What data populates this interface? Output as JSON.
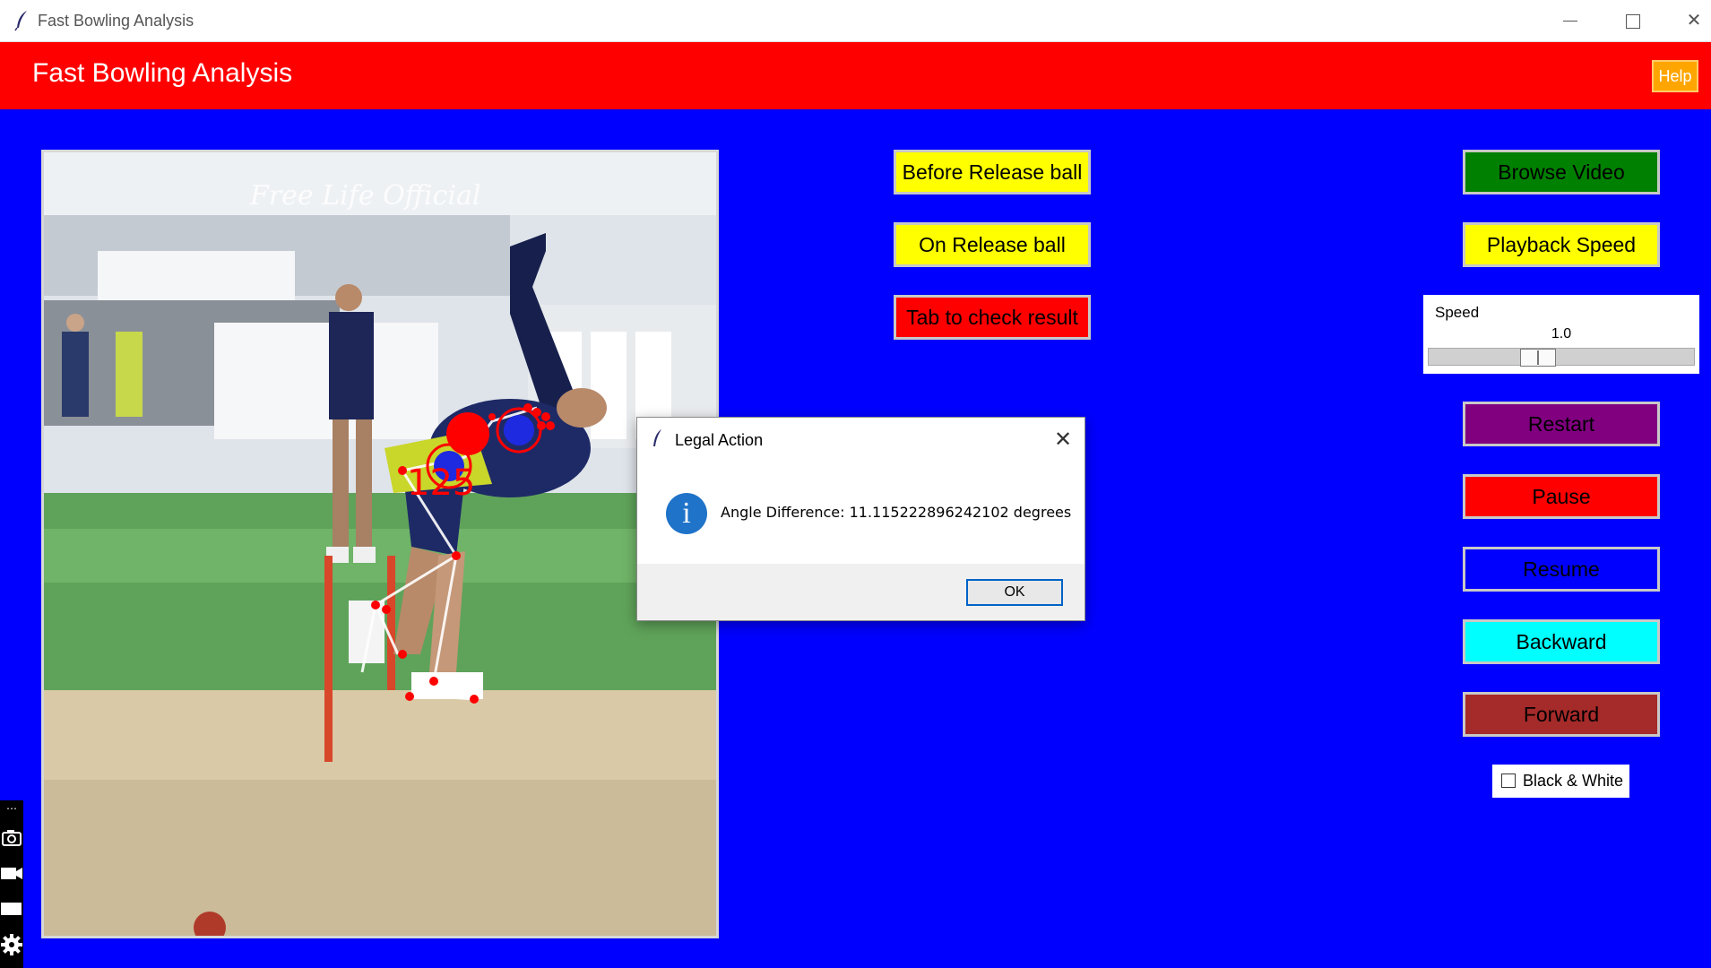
{
  "window": {
    "title": "Fast Bowling Analysis",
    "controls": [
      "minimize-icon",
      "maximize-icon",
      "close-icon"
    ]
  },
  "header": {
    "title": "Fast Bowling Analysis",
    "help_label": "Help"
  },
  "video": {
    "watermark": "Free Life Official",
    "overlay_angle": "125"
  },
  "left_buttons": {
    "before_release": "Before Release ball",
    "on_release": "On Release ball",
    "check_result": "Tab to check result"
  },
  "right_buttons": {
    "browse": "Browse Video",
    "playback_speed": "Playback Speed",
    "restart": "Restart",
    "pause": "Pause",
    "resume": "Resume",
    "backward": "Backward",
    "forward": "Forward"
  },
  "speed": {
    "label": "Speed",
    "value": "1.0",
    "slider_fraction": 0.4
  },
  "checkbox": {
    "label": "Black & White",
    "checked": false
  },
  "dialog": {
    "title": "Legal Action",
    "message": "Angle Difference: 11.115222896242102 degrees",
    "ok_label": "OK",
    "icon": "info-icon"
  },
  "colors": {
    "header": "#ff0000",
    "background": "#0000ff",
    "help": "#ffa500"
  }
}
